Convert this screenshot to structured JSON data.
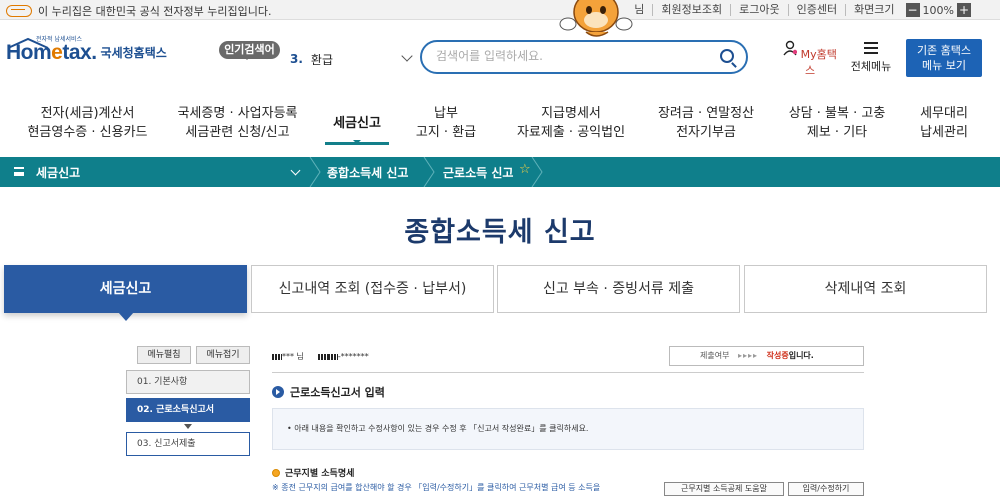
{
  "topbar": {
    "gov_notice": "이 누리집은 대한민국 공식 전자정부 누리집입니다.",
    "links": [
      "님",
      "회원정보조회",
      "로그아웃",
      "인증센터",
      "화면크기"
    ],
    "zoom_minus": "−",
    "zoom_level": "100%",
    "zoom_plus": "+"
  },
  "header": {
    "logo_sub": "전자적 납세서비스",
    "logo_text_1": "Hom",
    "logo_text_2": "e",
    "logo_text_3": "tax.",
    "logo_kr": "국세청홈택스",
    "popular_label": "인기검색어",
    "popular_rank": "3.",
    "popular_term": "환급",
    "search_placeholder": "검색어를 입력하세요.",
    "mytax_label": "My홈택스",
    "allmenu_label": "전체메뉴",
    "oldhome_line1": "기존 홈택스",
    "oldhome_line2": "메뉴 보기"
  },
  "gnb": [
    {
      "line1": "전자(세금)계산서",
      "line2": "현금영수증 · 신용카드"
    },
    {
      "line1": "국세증명 · 사업자등록",
      "line2": "세금관련 신청/신고"
    },
    {
      "line1": "세금신고",
      "line2": ""
    },
    {
      "line1": "납부",
      "line2": "고지 · 환급"
    },
    {
      "line1": "지급명세서",
      "line2": "자료제출 · 공익법인"
    },
    {
      "line1": "장려금 · 연말정산",
      "line2": "전자기부금"
    },
    {
      "line1": "상담 · 불복 · 고충",
      "line2": "제보 · 기타"
    },
    {
      "line1": "세무대리",
      "line2": "납세관리"
    }
  ],
  "breadcrumb": {
    "level1": "세금신고",
    "level2": "종합소득세 신고",
    "level3": "근로소득 신고"
  },
  "page_title": "종합소득세 신고",
  "tabs": [
    "세금신고",
    "신고내역 조회 (접수증 · 납부서)",
    "신고 부속 · 증빙서류 제출",
    "삭제내역 조회"
  ],
  "sidemenu": {
    "expand_label": "메뉴펼침",
    "collapse_label": "메뉴접기",
    "steps": [
      "01. 기본사항",
      "02. 근로소득신고서",
      "03. 신고서제출"
    ]
  },
  "main": {
    "user_name": "***",
    "user_suffix": "님",
    "user_id_tail": "-*******",
    "status_label": "제출여부",
    "status_arrows": "▸▸▸▸",
    "status_state": "작성중",
    "status_suffix": "입니다.",
    "section_title": "근로소득신고서 입력",
    "info_text": "• 아래 내용을 확인하고 수정사항이 있는 경우 수정 후 「신고서 작성완료」를 클릭하세요.",
    "sub_title": "근무지별 소득명세",
    "note_text": "※ 종전 근무지의 급여를 합산해야 할 경우 「입력/수정하기」를 클릭하여 근무처별 급여 등 소득을",
    "btn_help": "근무지별 소득공제 도움말",
    "btn_edit": "입력/수정하기"
  },
  "colors": {
    "brand_blue": "#1d4f91",
    "teal_bar": "#0f7f8b",
    "active_tab": "#2a5ba3",
    "accent_orange": "#e07a00",
    "status_red": "#d0321d"
  }
}
